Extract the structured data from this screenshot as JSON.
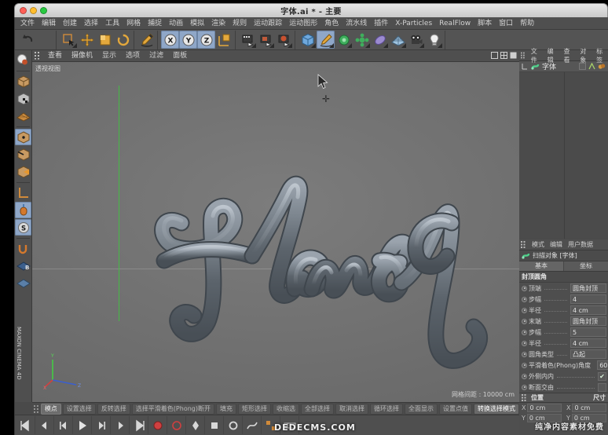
{
  "window": {
    "title": "字体.ai * - 主要",
    "traffic_lights": [
      "close",
      "minimize",
      "maximize"
    ]
  },
  "menubar": {
    "items": [
      {
        "label": "文件"
      },
      {
        "label": "编辑"
      },
      {
        "label": "创建"
      },
      {
        "label": "选择"
      },
      {
        "label": "工具"
      },
      {
        "label": "网格"
      },
      {
        "label": "捕捉"
      },
      {
        "label": "动画"
      },
      {
        "label": "模拟"
      },
      {
        "label": "渲染"
      },
      {
        "label": "规则"
      },
      {
        "label": "运动跟踪"
      },
      {
        "label": "运动图形"
      },
      {
        "label": "角色"
      },
      {
        "label": "流水线"
      },
      {
        "label": "插件"
      },
      {
        "label": "X-Particles"
      },
      {
        "label": "RealFlow"
      },
      {
        "label": "脚本"
      },
      {
        "label": "窗口"
      },
      {
        "label": "帮助"
      }
    ]
  },
  "toolbar": {
    "groups": [
      {
        "buttons": [
          {
            "name": "undo-icon",
            "selected": false
          }
        ]
      },
      {
        "buttons": [
          {
            "name": "select-live-icon",
            "selected": false
          },
          {
            "name": "move-icon",
            "selected": false
          },
          {
            "name": "scale-icon",
            "selected": false
          },
          {
            "name": "rotate-icon",
            "selected": false
          }
        ]
      },
      {
        "buttons": [
          {
            "name": "brush-icon",
            "selected": false
          }
        ]
      },
      {
        "buttons": [
          {
            "name": "axis-x-icon",
            "label": "X",
            "selected": true
          },
          {
            "name": "axis-y-icon",
            "label": "Y",
            "selected": true
          },
          {
            "name": "axis-z-icon",
            "label": "Z",
            "selected": true
          },
          {
            "name": "world-axis-icon",
            "selected": false
          }
        ]
      },
      {
        "buttons": [
          {
            "name": "render-view-icon",
            "selected": false
          },
          {
            "name": "render-region-icon",
            "selected": false
          },
          {
            "name": "render-settings-icon",
            "selected": false
          }
        ]
      },
      {
        "buttons": [
          {
            "name": "cube-primitive-icon",
            "selected": false
          },
          {
            "name": "spline-pen-icon",
            "selected": true
          },
          {
            "name": "generator-icon",
            "selected": false
          },
          {
            "name": "deformer-icon",
            "selected": false
          },
          {
            "name": "environment-icon",
            "selected": false
          },
          {
            "name": "floor-scene-icon",
            "selected": false
          },
          {
            "name": "camera-icon",
            "selected": false
          },
          {
            "name": "light-icon",
            "selected": false
          }
        ]
      }
    ]
  },
  "left_palette": {
    "buttons": [
      {
        "name": "live-selection-icon",
        "selected": false
      },
      {
        "name": "model-mode-icon",
        "selected": false
      },
      {
        "name": "texture-mode-icon",
        "selected": false
      },
      {
        "name": "workplane-icon",
        "selected": false
      },
      {
        "name": "point-mode-icon",
        "selected": true
      },
      {
        "name": "edge-mode-icon",
        "selected": false
      },
      {
        "name": "polygon-mode-icon",
        "selected": false
      },
      {
        "name": "axis-mode-icon",
        "selected": false
      },
      {
        "name": "enable-axis-icon",
        "selected": true
      },
      {
        "name": "snap-mode-icon",
        "selected": true
      },
      {
        "name": "uv-mode-icon",
        "selected": false
      },
      {
        "name": "texture-axis-icon",
        "selected": false
      }
    ]
  },
  "viewport": {
    "menu": [
      {
        "label": "查看"
      },
      {
        "label": "摄像机"
      },
      {
        "label": "显示"
      },
      {
        "label": "选项"
      },
      {
        "label": "过滤"
      },
      {
        "label": "面板"
      }
    ],
    "label": "透视视图",
    "status": "网格间距 : 10000 cm",
    "object_text": "Flowed",
    "gizmo_axes": [
      "X",
      "Y",
      "Z"
    ]
  },
  "mode_strip": {
    "items": [
      {
        "label": "模点",
        "state": "active"
      },
      {
        "label": "设置选择",
        "state": "normal"
      },
      {
        "label": "反转选择",
        "state": "normal"
      },
      {
        "label": "选择平滑着色(Phong)断开",
        "state": "normal"
      },
      {
        "label": "填充",
        "state": "normal"
      },
      {
        "label": "矩形选择",
        "state": "normal"
      },
      {
        "label": "收缩选",
        "state": "normal"
      },
      {
        "label": "全部选择",
        "state": "normal"
      },
      {
        "label": "取消选择",
        "state": "normal"
      },
      {
        "label": "循环选择",
        "state": "normal"
      },
      {
        "label": "全面显示",
        "state": "normal"
      },
      {
        "label": "设置点值",
        "state": "normal"
      },
      {
        "label": "转换选择模式",
        "state": "strong"
      }
    ]
  },
  "bottom_toolbar": {
    "buttons": [
      {
        "name": "play-back-icon"
      },
      {
        "name": "step-back-icon"
      },
      {
        "name": "prev-key-icon"
      },
      {
        "name": "play-icon"
      },
      {
        "name": "next-key-icon"
      },
      {
        "name": "step-forward-icon"
      },
      {
        "name": "play-forward-icon"
      },
      {
        "name": "record-key-icon"
      },
      {
        "name": "autokey-icon"
      },
      {
        "name": "keyframe-position-icon"
      },
      {
        "name": "keyframe-scale-icon"
      },
      {
        "name": "keyframe-rotation-icon"
      },
      {
        "name": "keyframe-param-icon"
      },
      {
        "name": "point-level-icon"
      },
      {
        "name": "timeline-icon"
      }
    ]
  },
  "object_manager": {
    "menu": [
      {
        "label": "文件"
      },
      {
        "label": "编辑"
      },
      {
        "label": "查看"
      },
      {
        "label": "对象"
      },
      {
        "label": "标签"
      }
    ],
    "objects": [
      {
        "name": "字体",
        "icon": "sweep-object-icon",
        "tags": [
          "phong-tag",
          "spline-tag",
          "material-tag"
        ]
      }
    ]
  },
  "attribute_manager": {
    "menu": [
      {
        "label": "模式"
      },
      {
        "label": "编辑"
      },
      {
        "label": "用户数据"
      }
    ],
    "object_title": "扫描对象 [字体]",
    "tabs": [
      {
        "label": "基本",
        "active": true
      },
      {
        "label": "坐标",
        "active": false
      }
    ],
    "section_title": "封顶圆角",
    "properties": [
      {
        "label": "顶端",
        "value": "圆角封顶",
        "type": "dropdown"
      },
      {
        "label": "步幅",
        "value": "4",
        "type": "number"
      },
      {
        "label": "半径",
        "value": "4 cm",
        "type": "number"
      },
      {
        "label": "末端",
        "value": "圆角封顶",
        "type": "dropdown"
      },
      {
        "label": "步幅",
        "value": "5",
        "type": "number"
      },
      {
        "label": "半径",
        "value": "4 cm",
        "type": "number"
      },
      {
        "label": "圆角类型",
        "value": "凸起",
        "type": "dropdown"
      },
      {
        "label": "平滑着色(Phong)角度",
        "value": "60 °",
        "type": "number"
      },
      {
        "label": "外侧内内",
        "value": "✔",
        "type": "checkbox"
      },
      {
        "label": "断面交由",
        "value": "",
        "type": "checkbox"
      }
    ],
    "coordinates": {
      "title": "位置",
      "col2_title": "尺寸",
      "rows": [
        {
          "axis": "X",
          "value": "0 cm",
          "axis2": "X",
          "value2": "0 cm"
        },
        {
          "axis": "Y",
          "value": "0 cm",
          "axis2": "Y",
          "value2": "0 cm"
        }
      ]
    }
  },
  "branding": {
    "vertical": "MAXON CINEMA 4D",
    "watermark": "纯净内容素材免费",
    "watermark2": "DEDECMS.COM"
  }
}
